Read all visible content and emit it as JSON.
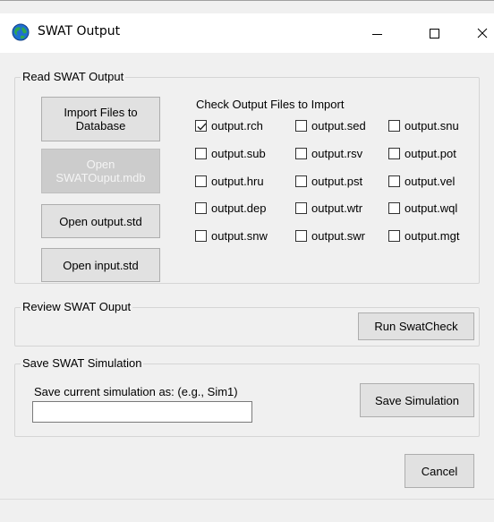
{
  "window": {
    "title": "SWAT Output",
    "minimize": "—",
    "close": "✕"
  },
  "read_group": {
    "label": "Read SWAT Output",
    "import_button": "Import Files to\nDatabase",
    "open_mdb_button": "Open\nSWATOuput.mdb",
    "open_std_button": "Open output.std",
    "open_input_button": "Open input.std",
    "check_label": "Check Output Files to Import",
    "files": [
      {
        "label": "output.rch",
        "checked": true
      },
      {
        "label": "output.sed",
        "checked": false
      },
      {
        "label": "output.snu",
        "checked": false
      },
      {
        "label": "output.sub",
        "checked": false
      },
      {
        "label": "output.rsv",
        "checked": false
      },
      {
        "label": "output.pot",
        "checked": false
      },
      {
        "label": "output.hru",
        "checked": false
      },
      {
        "label": "output.pst",
        "checked": false
      },
      {
        "label": "output.vel",
        "checked": false
      },
      {
        "label": "output.dep",
        "checked": false
      },
      {
        "label": "output.wtr",
        "checked": false
      },
      {
        "label": "output.wql",
        "checked": false
      },
      {
        "label": "output.snw",
        "checked": false
      },
      {
        "label": "output.swr",
        "checked": false
      },
      {
        "label": "output.mgt",
        "checked": false
      }
    ]
  },
  "review_group": {
    "label": "Review SWAT Ouput",
    "run_button": "Run SwatCheck"
  },
  "save_group": {
    "label": "Save SWAT Simulation",
    "prompt": "Save current simulation as: (e.g., Sim1)",
    "input_value": "",
    "save_button": "Save Simulation"
  },
  "footer": {
    "cancel_button": "Cancel"
  },
  "colors": {
    "button_bg": "#e1e1e1",
    "disabled_button_bg": "#cccccc",
    "window_bg": "#f0f0f0"
  }
}
